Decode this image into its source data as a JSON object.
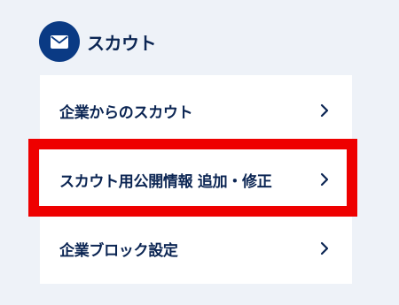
{
  "section": {
    "icon": "envelope-icon",
    "title": "スカウト"
  },
  "menu": {
    "items": [
      {
        "label": "企業からのスカウト",
        "icon": "chevron-right-icon"
      },
      {
        "label": "スカウト用公開情報 追加・修正",
        "icon": "chevron-right-icon",
        "highlighted": true
      },
      {
        "label": "企業ブロック設定",
        "icon": "chevron-right-icon"
      }
    ]
  },
  "colors": {
    "background": "#eef2f8",
    "accent": "#0a3a84",
    "text": "#0b2553",
    "highlight": "#ee0000",
    "card": "#ffffff"
  }
}
